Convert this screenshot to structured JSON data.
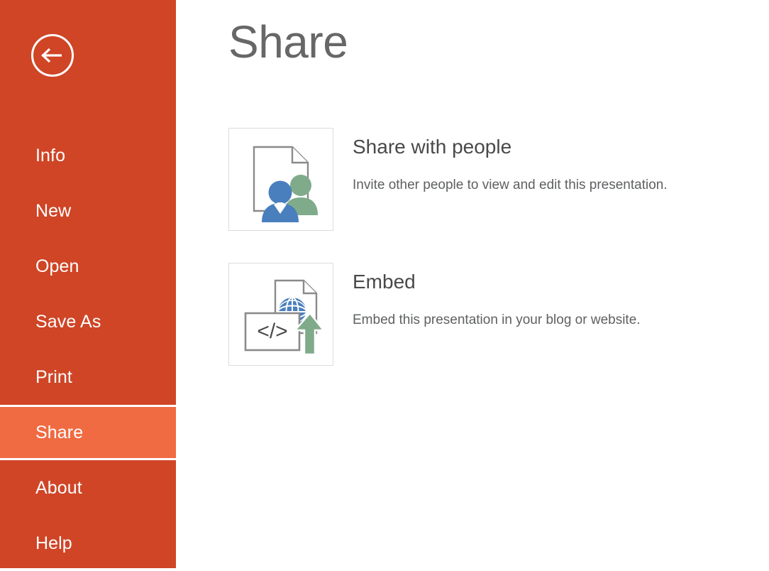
{
  "sidebar": {
    "background_color": "#cf4526",
    "active_color": "#f06a42",
    "back_button": {
      "icon": "back-arrow-icon",
      "label": "Back"
    },
    "items": [
      {
        "label": "Info",
        "active": false
      },
      {
        "label": "New",
        "active": false
      },
      {
        "label": "Open",
        "active": false
      },
      {
        "label": "Save As",
        "active": false
      },
      {
        "label": "Print",
        "active": false
      },
      {
        "label": "Share",
        "active": true
      },
      {
        "label": "About",
        "active": false
      },
      {
        "label": "Help",
        "active": false
      }
    ]
  },
  "main": {
    "title": "Share",
    "title_color": "#676767",
    "options": [
      {
        "icon": "share-with-people-icon",
        "heading": "Share with people",
        "description": "Invite other people to view and edit this presentation."
      },
      {
        "icon": "embed-icon",
        "heading": "Embed",
        "description": "Embed this presentation in your blog or website."
      }
    ]
  },
  "colors": {
    "accent_orange": "#cf4526",
    "accent_orange_light": "#f06a42",
    "icon_blue": "#4a7fbd",
    "icon_green": "#7fab8b",
    "icon_gray": "#8a8a8a",
    "tile_border": "#dcdcdc",
    "heading_gray": "#494949",
    "body_gray": "#5e6062"
  }
}
